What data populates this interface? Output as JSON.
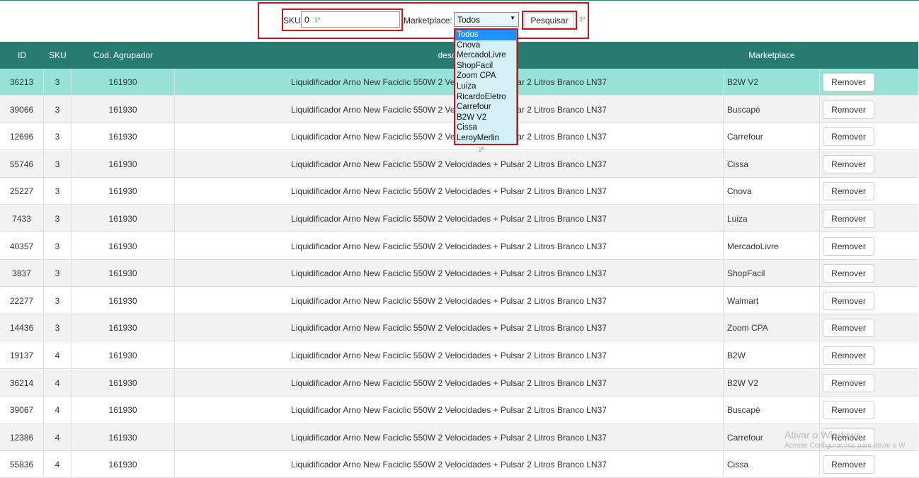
{
  "filters": {
    "sku_label": "SKU",
    "sku_value": "0",
    "marketplace_label": "Marketplace:",
    "marketplace_selected": "Todos",
    "search_button": "Pesquisar",
    "step1": "1º",
    "step2": "2º",
    "step3": "3º"
  },
  "dropdown": {
    "options": [
      "Todos",
      "Cnova",
      "MercadoLivre",
      "ShopFacil",
      "Zoom CPA",
      "Luiza",
      "RicardoEletro",
      "Carrefour",
      "B2W V2",
      "Cissa",
      "LeroyMerlin"
    ]
  },
  "table": {
    "headers": {
      "id": "ID",
      "sku": "SKU",
      "cod": "Cod. Agrupador",
      "desc": "descri",
      "mkt": "Marketplace"
    },
    "remove_label": "Remover",
    "rows": [
      {
        "id": "36213",
        "sku": "3",
        "cod": "161930",
        "desc": "Liquidificador Arno New Faciclic 550W 2 Velocidades + Pulsar 2 Litros Branco LN37",
        "mkt": "B2W V2"
      },
      {
        "id": "39066",
        "sku": "3",
        "cod": "161930",
        "desc": "Liquidificador Arno New Faciclic 550W 2 Velocidades + Pulsar 2 Litros Branco LN37",
        "mkt": "Buscapé"
      },
      {
        "id": "12696",
        "sku": "3",
        "cod": "161930",
        "desc": "Liquidificador Arno New Faciclic 550W 2 Velocidades + Pulsar 2 Litros Branco LN37",
        "mkt": "Carrefour"
      },
      {
        "id": "55746",
        "sku": "3",
        "cod": "161930",
        "desc": "Liquidificador Arno New Faciclic 550W 2 Velocidades + Pulsar 2 Litros Branco LN37",
        "mkt": "Cissa"
      },
      {
        "id": "25227",
        "sku": "3",
        "cod": "161930",
        "desc": "Liquidificador Arno New Faciclic 550W 2 Velocidades + Pulsar 2 Litros Branco LN37",
        "mkt": "Cnova"
      },
      {
        "id": "7433",
        "sku": "3",
        "cod": "161930",
        "desc": "Liquidificador Arno New Faciclic 550W 2 Velocidades + Pulsar 2 Litros Branco LN37",
        "mkt": "Luiza"
      },
      {
        "id": "40357",
        "sku": "3",
        "cod": "161930",
        "desc": "Liquidificador Arno New Faciclic 550W 2 Velocidades + Pulsar 2 Litros Branco LN37",
        "mkt": "MercadoLivre"
      },
      {
        "id": "3837",
        "sku": "3",
        "cod": "161930",
        "desc": "Liquidificador Arno New Faciclic 550W 2 Velocidades + Pulsar 2 Litros Branco LN37",
        "mkt": "ShopFacil"
      },
      {
        "id": "22277",
        "sku": "3",
        "cod": "161930",
        "desc": "Liquidificador Arno New Faciclic 550W 2 Velocidades + Pulsar 2 Litros Branco LN37",
        "mkt": "Walmart"
      },
      {
        "id": "14436",
        "sku": "3",
        "cod": "161930",
        "desc": "Liquidificador Arno New Faciclic 550W 2 Velocidades + Pulsar 2 Litros Branco LN37",
        "mkt": "Zoom CPA"
      },
      {
        "id": "19137",
        "sku": "4",
        "cod": "161930",
        "desc": "Liquidificador Arno New Faciclic 550W 2 Velocidades + Pulsar 2 Litros Branco LN37",
        "mkt": "B2W"
      },
      {
        "id": "36214",
        "sku": "4",
        "cod": "161930",
        "desc": "Liquidificador Arno New Faciclic 550W 2 Velocidades + Pulsar 2 Litros Branco LN37",
        "mkt": "B2W V2"
      },
      {
        "id": "39067",
        "sku": "4",
        "cod": "161930",
        "desc": "Liquidificador Arno New Faciclic 550W 2 Velocidades + Pulsar 2 Litros Branco LN37",
        "mkt": "Buscapé"
      },
      {
        "id": "12386",
        "sku": "4",
        "cod": "161930",
        "desc": "Liquidificador Arno New Faciclic 550W 2 Velocidades + Pulsar 2 Litros Branco LN37",
        "mkt": "Carrefour"
      },
      {
        "id": "55836",
        "sku": "4",
        "cod": "161930",
        "desc": "Liquidificador Arno New Faciclic 550W 2 Velocidades + Pulsar 2 Litros Branco LN37",
        "mkt": "Cissa"
      }
    ]
  },
  "watermark": {
    "line1": "Ativar o Windows",
    "line2": "Acesse Configurações para ativar o W"
  },
  "colors": {
    "header_bg": "#267c70",
    "selected_row": "#97e2d6",
    "annotation_red": "#d0131b",
    "dropdown_highlight": "#1e90ff"
  }
}
